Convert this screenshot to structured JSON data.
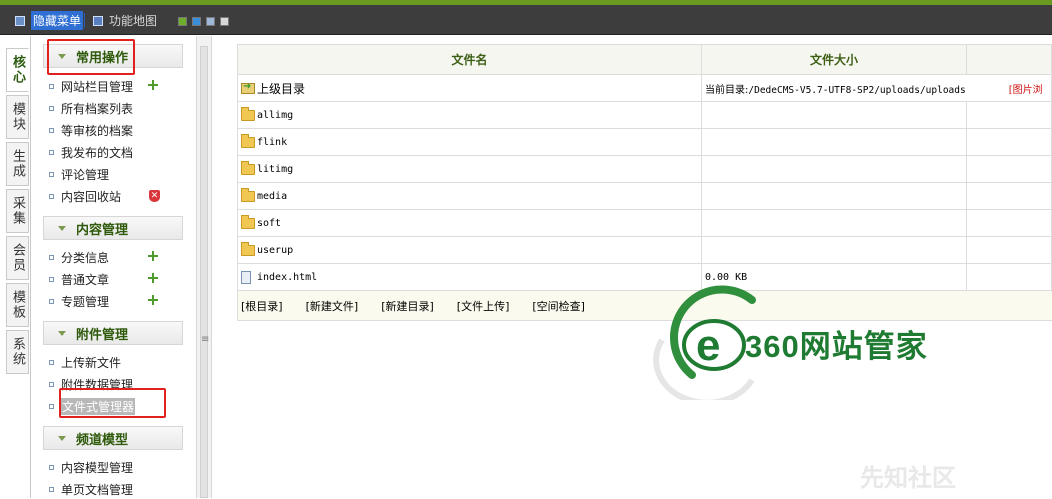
{
  "topbar": {
    "hide_menu": "隐藏菜单",
    "site_map": "功能地图",
    "color_swatches": [
      "#6fae2a",
      "#3b8fd9",
      "#9fb8d9",
      "#d8d8d8"
    ]
  },
  "vtabs": [
    "核心",
    "模块",
    "生成",
    "采集",
    "会员",
    "模板",
    "系统"
  ],
  "sections": [
    {
      "title": "常用操作",
      "items": [
        "网站栏目管理",
        "所有档案列表",
        "等审核的档案",
        "我发布的文档",
        "评论管理",
        "内容回收站"
      ]
    },
    {
      "title": "内容管理",
      "items": [
        "分类信息",
        "普通文章",
        "专题管理"
      ]
    },
    {
      "title": "附件管理",
      "items": [
        "上传新文件",
        "附件数据管理",
        "文件式管理器"
      ]
    },
    {
      "title": "频道模型",
      "items": [
        "内容模型管理",
        "单页文档管理"
      ]
    }
  ],
  "table": {
    "headers": [
      "文件名",
      "文件大小"
    ],
    "parent_dir": "上级目录",
    "current_dir_label": "当前目录:",
    "current_dir_path": "/DedeCMS-V5.7-UTF8-SP2/uploads/uploads",
    "image_view": "[图片浏",
    "folders": [
      "allimg",
      "flink",
      "litimg",
      "media",
      "soft",
      "userup"
    ],
    "file": {
      "name": "index.html",
      "size": "0.00 KB"
    }
  },
  "actions": [
    "[根目录]",
    "[新建文件]",
    "[新建目录]",
    "[文件上传]",
    "[空间检查]"
  ],
  "watermark": {
    "text": "360网站管家",
    "site": "先知社区"
  }
}
